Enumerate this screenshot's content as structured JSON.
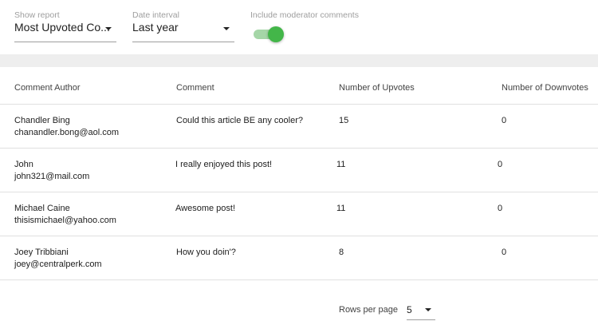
{
  "filters": {
    "report": {
      "label": "Show report",
      "value": "Most Upvoted Co..."
    },
    "interval": {
      "label": "Date interval",
      "value": "Last year"
    },
    "moderator": {
      "label": "Include moderator comments",
      "enabled": true
    }
  },
  "table": {
    "headers": {
      "author": "Comment Author",
      "comment": "Comment",
      "upvotes": "Number of Upvotes",
      "downvotes": "Number of Downvotes"
    },
    "rows": [
      {
        "name": "Chandler Bing",
        "email": "chanandler.bong@aol.com",
        "comment": "Could this article BE any cooler?",
        "upvotes": "15",
        "downvotes": "0"
      },
      {
        "name": "John",
        "email": "john321@mail.com",
        "comment": "I really enjoyed this post!",
        "upvotes": "11",
        "downvotes": "0"
      },
      {
        "name": "Michael Caine",
        "email": "thisismichael@yahoo.com",
        "comment": "Awesome post!",
        "upvotes": "11",
        "downvotes": "0"
      },
      {
        "name": "Joey Tribbiani",
        "email": "joey@centralperk.com",
        "comment": "How you doin'?",
        "upvotes": "8",
        "downvotes": "0"
      }
    ]
  },
  "pagination": {
    "label": "Rows per page",
    "value": "5"
  },
  "colors": {
    "accent": "#43b649",
    "track": "#a5d6a7",
    "band": "#eeeeee"
  }
}
